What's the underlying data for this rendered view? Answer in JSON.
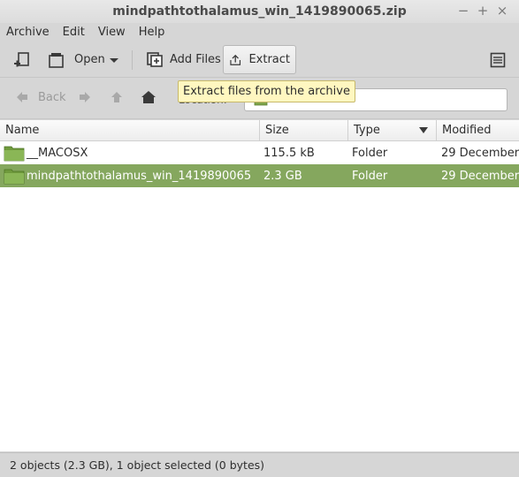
{
  "window": {
    "title": "mindpathtothalamus_win_1419890065.zip",
    "controls": [
      "−",
      "+",
      "×"
    ]
  },
  "menu": [
    "Archive",
    "Edit",
    "View",
    "Help"
  ],
  "toolbar": {
    "open_label": "Open",
    "add_files_label": "Add Files",
    "extract_label": "Extract"
  },
  "tooltip": "Extract files from the archive",
  "nav": {
    "back_label": "Back",
    "location_label": "Location:"
  },
  "columns": [
    "Name",
    "Size",
    "Type",
    "Modified"
  ],
  "rows": [
    {
      "name": "__MACOSX",
      "size": "115.5 kB",
      "type": "Folder",
      "modified": "29 December",
      "selected": false
    },
    {
      "name": "mindpathtothalamus_win_1419890065",
      "size": "2.3 GB",
      "type": "Folder",
      "modified": "29 December",
      "selected": true
    }
  ],
  "status": "2 objects (2.3 GB), 1 object selected (0 bytes)",
  "colors": {
    "selection": "#85a75e",
    "folder": "#7fa44a",
    "tooltip_bg": "#fff7c0"
  }
}
